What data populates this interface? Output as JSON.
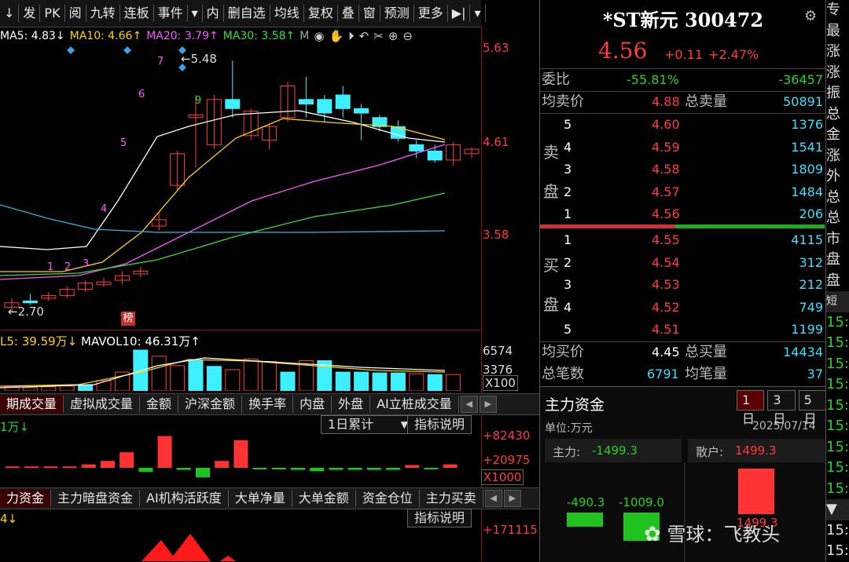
{
  "toolbar": {
    "items": [
      "↓",
      "发",
      "PK",
      "阅",
      "九转",
      "连板",
      "事件",
      "▾",
      "内",
      "删自选",
      "均线",
      "复权",
      "叠",
      "窗",
      "预测",
      "更多",
      "▶|",
      "▾"
    ]
  },
  "ma_row": {
    "ma5": "MA5: 4.83↓",
    "ma10": "MA10: 4.66↑",
    "ma20": "MA20: 3.79↑",
    "ma30": "MA30: 3.58↑",
    "more": "M"
  },
  "price_axis": {
    "top": "5.63",
    "mid": "4.61",
    "bottom": "3.58"
  },
  "annotations": {
    "high": "5.48",
    "low": "2.70",
    "bang": "榜",
    "nums": [
      "1",
      "2",
      "3",
      "4",
      "5",
      "6",
      "7",
      "9"
    ]
  },
  "volume": {
    "header_l5": "L5: 39.59万↓",
    "header_mavol10": "MAVOL10: 46.31万↑",
    "axis_top": "6574",
    "axis_mid": "3376",
    "axis_unit": "X100",
    "bars": [
      {
        "v": 0.1,
        "c": "red"
      },
      {
        "v": 0.08,
        "c": "red"
      },
      {
        "v": 0.1,
        "c": "red"
      },
      {
        "v": 0.12,
        "c": "red"
      },
      {
        "v": 0.15,
        "c": "cyan"
      },
      {
        "v": 0.25,
        "c": "red"
      },
      {
        "v": 0.46,
        "c": "red"
      },
      {
        "v": 1.0,
        "c": "cyan"
      },
      {
        "v": 0.85,
        "c": "red"
      },
      {
        "v": 0.62,
        "c": "red"
      },
      {
        "v": 0.74,
        "c": "cyan"
      },
      {
        "v": 0.6,
        "c": "cyan"
      },
      {
        "v": 0.52,
        "c": "red"
      },
      {
        "v": 0.78,
        "c": "red"
      },
      {
        "v": 0.72,
        "c": "red"
      },
      {
        "v": 0.46,
        "c": "cyan"
      },
      {
        "v": 0.74,
        "c": "red"
      },
      {
        "v": 0.74,
        "c": "cyan"
      },
      {
        "v": 0.46,
        "c": "cyan"
      },
      {
        "v": 0.46,
        "c": "cyan"
      },
      {
        "v": 0.44,
        "c": "cyan"
      },
      {
        "v": 0.44,
        "c": "cyan"
      },
      {
        "v": 0.42,
        "c": "red"
      },
      {
        "v": 0.4,
        "c": "cyan"
      },
      {
        "v": 0.4,
        "c": "red"
      }
    ]
  },
  "vol_tabs": [
    "期成交量",
    "虚拟成交量",
    "金额",
    "沪深金额",
    "换手率",
    "内盘",
    "外盘",
    "AI立桩成交量"
  ],
  "fund": {
    "header": "1万↓",
    "period_select": "1日累计",
    "explain_btn": "指标说明",
    "axis_top": "+82430",
    "axis_mid": "+20975",
    "axis_unit": "X1000",
    "bars": [
      {
        "v": 0.04,
        "c": "red"
      },
      {
        "v": 0.04,
        "c": "red"
      },
      {
        "v": 0.04,
        "c": "red"
      },
      {
        "v": 0.04,
        "c": "red"
      },
      {
        "v": 0.1,
        "c": "red"
      },
      {
        "v": 0.2,
        "c": "red"
      },
      {
        "v": 0.45,
        "c": "red"
      },
      {
        "v": -0.12,
        "c": "green"
      },
      {
        "v": 0.92,
        "c": "red"
      },
      {
        "v": -0.06,
        "c": "green"
      },
      {
        "v": -0.28,
        "c": "green"
      },
      {
        "v": 0.2,
        "c": "red"
      },
      {
        "v": 0.8,
        "c": "red"
      },
      {
        "v": -0.04,
        "c": "green"
      },
      {
        "v": -0.04,
        "c": "green"
      },
      {
        "v": -0.06,
        "c": "green"
      },
      {
        "v": -0.1,
        "c": "green"
      },
      {
        "v": -0.06,
        "c": "green"
      },
      {
        "v": -0.06,
        "c": "green"
      },
      {
        "v": -0.06,
        "c": "green"
      },
      {
        "v": -0.06,
        "c": "green"
      },
      {
        "v": 0.08,
        "c": "red"
      },
      {
        "v": -0.04,
        "c": "green"
      },
      {
        "v": 0.1,
        "c": "red"
      }
    ]
  },
  "fund_tabs": [
    "力资金",
    "主力暗盘资金",
    "AI机构活跃度",
    "大单净量",
    "大单金额",
    "资金仓位",
    "主力买卖"
  ],
  "bottom": {
    "header": "4↓",
    "explain_btn": "指标说明",
    "axis_top": "+171115"
  },
  "quote": {
    "name": "*ST新元 300472",
    "price": "4.56",
    "change": "+0.11",
    "change_pct": "+2.47%",
    "webi_label": "委比",
    "webi_value": "-55.81%",
    "webi_diff": "-36457",
    "avg_sell_label": "均卖价",
    "avg_sell_value": "4.88",
    "total_sell_label": "总卖量",
    "total_sell_value": "50891",
    "sell_label_1": "卖",
    "sell_label_2": "盘",
    "buy_label_1": "买",
    "buy_label_2": "盘",
    "sells": [
      {
        "lvl": "5",
        "price": "4.60",
        "vol": "1376"
      },
      {
        "lvl": "4",
        "price": "4.59",
        "vol": "1541"
      },
      {
        "lvl": "3",
        "price": "4.58",
        "vol": "1809"
      },
      {
        "lvl": "2",
        "price": "4.57",
        "vol": "1484"
      },
      {
        "lvl": "1",
        "price": "4.56",
        "vol": "206"
      }
    ],
    "buys": [
      {
        "lvl": "1",
        "price": "4.55",
        "vol": "4115"
      },
      {
        "lvl": "2",
        "price": "4.54",
        "vol": "312"
      },
      {
        "lvl": "3",
        "price": "4.53",
        "vol": "212"
      },
      {
        "lvl": "4",
        "price": "4.52",
        "vol": "749"
      },
      {
        "lvl": "5",
        "price": "4.51",
        "vol": "1199"
      }
    ],
    "avg_buy_label": "均买价",
    "avg_buy_value": "4.45",
    "total_buy_label": "总买量",
    "total_buy_value": "14434",
    "total_trades_label": "总笔数",
    "total_trades_value": "6791",
    "avg_per_trade_label": "均笔量",
    "avg_per_trade_value": "37"
  },
  "main_fund": {
    "title": "主力资金",
    "periods": [
      "1日",
      "3日",
      "5日"
    ],
    "unit": "单位:万元",
    "date": "2025/07/14",
    "main_label": "主力:",
    "main_value": "-1499.3",
    "retail_label": "散户:",
    "retail_value": "1499.3",
    "bar1_label": "-490.3",
    "bar2_label": "-1009.0",
    "bar3_label": "1499.3"
  },
  "watermark": "雪球：飞教头",
  "side": {
    "items": [
      "专",
      "最",
      "涨",
      "涨",
      "振",
      "总",
      "金",
      "涨",
      "外",
      "总",
      "总",
      "市",
      "盘",
      "盘",
      "短",
      "15:",
      "15:",
      "15:",
      "15:",
      "15:",
      "15:",
      "15:",
      "15:",
      "15:"
    ],
    "bottom_items": [
      "15:",
      "15:"
    ]
  }
}
